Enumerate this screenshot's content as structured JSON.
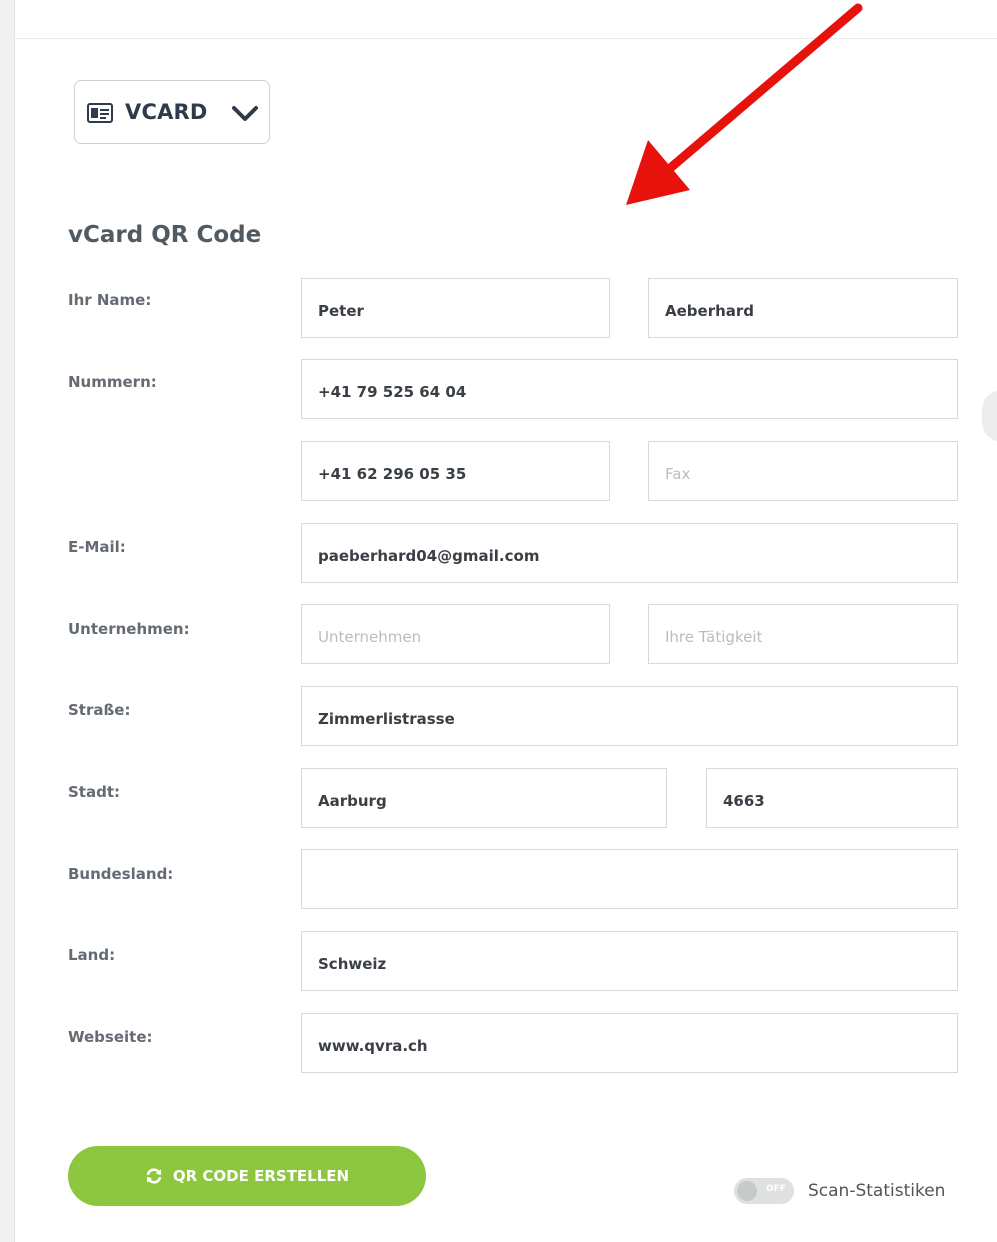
{
  "type_selector": {
    "label": "VCARD",
    "icon": "vcard-icon"
  },
  "section_title": "vCard QR Code",
  "labels": {
    "name": "Ihr Name:",
    "numbers": "Nummern:",
    "email": "E-Mail:",
    "company": "Unternehmen:",
    "street": "Straße:",
    "city": "Stadt:",
    "state": "Bundesland:",
    "country": "Land:",
    "website": "Webseite:"
  },
  "fields": {
    "first_name": {
      "value": "Peter",
      "placeholder": ""
    },
    "last_name": {
      "value": "Aeberhard",
      "placeholder": ""
    },
    "mobile": {
      "value": "+41 79 525 64 04",
      "placeholder": ""
    },
    "phone": {
      "value": "+41 62 296 05 35",
      "placeholder": ""
    },
    "fax": {
      "value": "",
      "placeholder": "Fax"
    },
    "email": {
      "value": "paeberhard04@gmail.com",
      "placeholder": ""
    },
    "company": {
      "value": "",
      "placeholder": "Unternehmen"
    },
    "job": {
      "value": "",
      "placeholder": "Ihre Tätigkeit"
    },
    "street": {
      "value": "Zimmerlistrasse",
      "placeholder": ""
    },
    "city": {
      "value": "Aarburg",
      "placeholder": ""
    },
    "zip": {
      "value": "4663",
      "placeholder": ""
    },
    "state": {
      "value": "",
      "placeholder": ""
    },
    "country": {
      "value": "Schweiz",
      "placeholder": ""
    },
    "website": {
      "value": "www.qvra.ch",
      "placeholder": ""
    }
  },
  "create_button": {
    "label": "QR CODE ERSTELLEN",
    "icon": "refresh-icon",
    "color": "#8dc63f"
  },
  "scan_stats": {
    "toggle_state": "OFF",
    "label": "Scan-Statistiken"
  },
  "annotation_arrow_color": "#e8120c"
}
